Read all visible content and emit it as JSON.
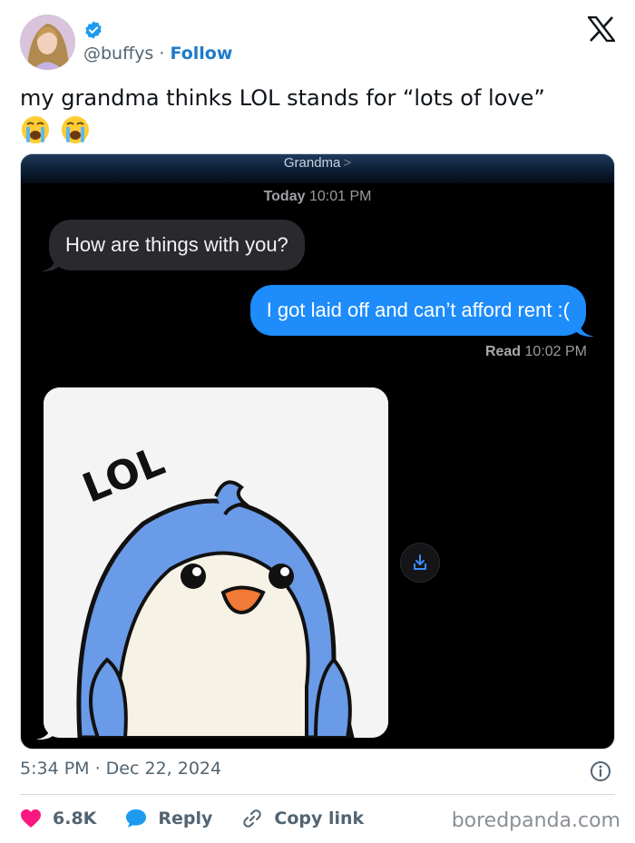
{
  "post": {
    "handle": "@buffys",
    "separator": "·",
    "follow_label": "Follow",
    "text": "my grandma thinks LOL stands for “lots of love”",
    "emojis": [
      "loudly-crying-face",
      "loudly-crying-face"
    ],
    "timestamp": "5:34 PM · Dec 22, 2024",
    "likes": "6.8K",
    "reply_label": "Reply",
    "copy_link_label": "Copy link"
  },
  "screenshot": {
    "contact_name": "Grandma",
    "contact_chevron": ">",
    "time_label_day": "Today",
    "time_label_time": "10:01 PM",
    "messages": [
      {
        "direction": "incoming",
        "text": "How are things with you?"
      },
      {
        "direction": "outgoing",
        "text": "I got laid off and can’t afford rent :("
      }
    ],
    "read_label": "Read",
    "read_time": "10:02 PM",
    "sticker_text": "LOL"
  },
  "watermark": "boredpanda.com",
  "colors": {
    "follow": "#1d7bc8",
    "verified": "#1d9bf0",
    "outgoing_bubble": "#1e8cfb",
    "incoming_bubble": "#2a2a2e",
    "like_heart": "#f91880",
    "reply_bubble": "#1d9bf0",
    "penguin_blue": "#6a9be8"
  }
}
